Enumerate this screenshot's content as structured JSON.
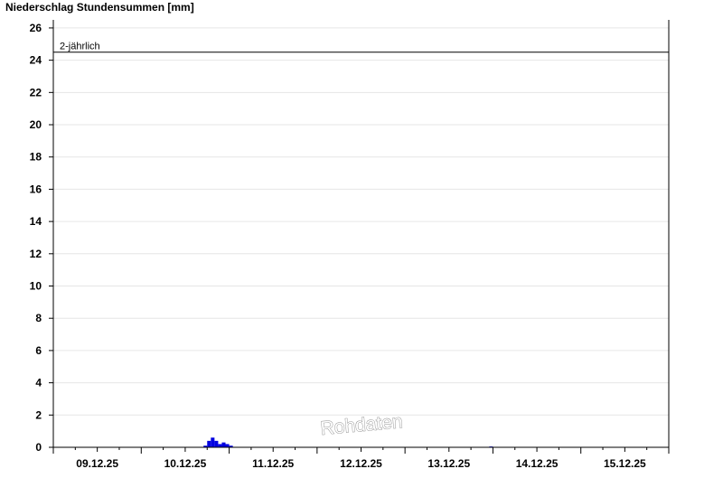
{
  "chart_data": {
    "type": "bar",
    "title": "Niederschlag Stundensummen [mm]",
    "xlabel": "",
    "ylabel": "",
    "ylim": [
      0,
      26.5
    ],
    "yticks": [
      0,
      2,
      4,
      6,
      8,
      10,
      12,
      14,
      16,
      18,
      20,
      22,
      24,
      26
    ],
    "xrange_hours": [
      0,
      168
    ],
    "day_labels": [
      "09.12.25",
      "10.12.25",
      "11.12.25",
      "12.12.25",
      "13.12.25",
      "14.12.25",
      "15.12.25"
    ],
    "grid": true,
    "bar_color": "#0000e0",
    "series": [
      {
        "hours": [
          41,
          42,
          43,
          44,
          45,
          46,
          47,
          48,
          119
        ],
        "values": [
          0.1,
          0.4,
          0.6,
          0.4,
          0.2,
          0.3,
          0.2,
          0.1,
          0.05
        ]
      }
    ],
    "threshold": {
      "label": "2-jährlich",
      "value": 24.5
    },
    "watermark": "Rohdaten"
  }
}
